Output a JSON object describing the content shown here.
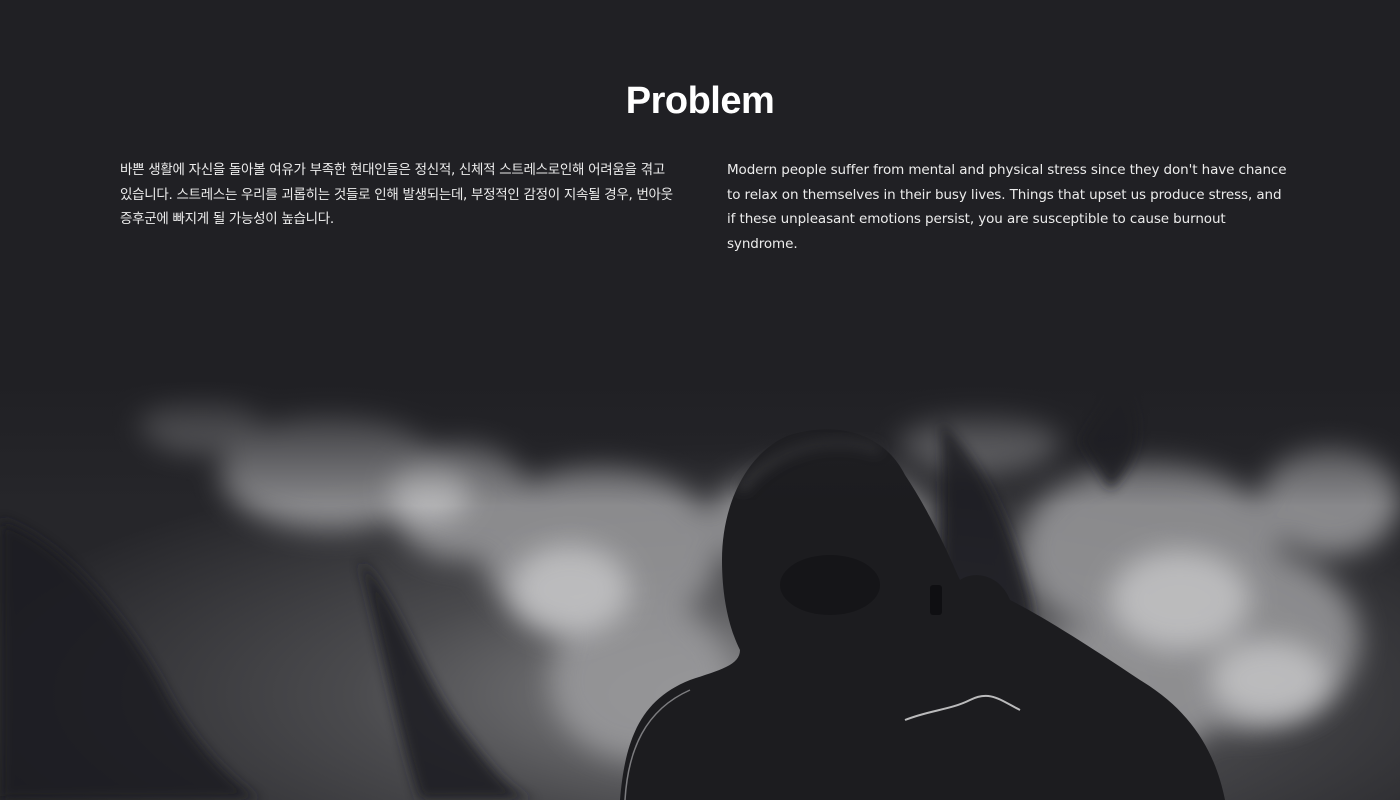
{
  "section": {
    "title": "Problem",
    "korean_text": "바쁜 생활에 자신을 돌아볼 여유가 부족한 현대인들은 정신적, 신체적 스트레스로인해 어려움을 겪고 있습니다. 스트레스는 우리를 괴롭히는 것들로 인해 발생되는데, 부정적인 감정이 지속될 경우, 번아웃 증후군에 빠지게 될 가능성이 높습니다.",
    "english_text": "Modern people suffer from mental and physical stress since they don't have chance to relax on themselves in their busy lives. Things that upset us produce stress, and if these unpleasant emotions persist, you are susceptible to cause burnout syndrome."
  },
  "colors": {
    "background": "#202024",
    "text": "#ececec",
    "title": "#ffffff"
  }
}
